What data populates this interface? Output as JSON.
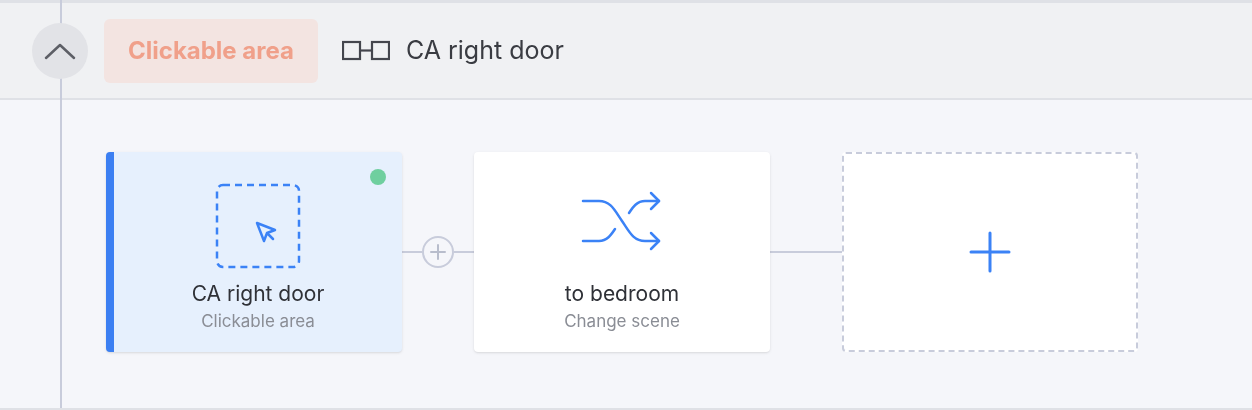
{
  "header": {
    "expanded": true,
    "badge": "Clickable area",
    "title": "CA right door"
  },
  "nodes": [
    {
      "kind": "clickable_area",
      "title": "CA right door",
      "subtitle": "Clickable area",
      "selected": true,
      "color": "#6fcf9f"
    },
    {
      "kind": "change_scene",
      "title": "to bedroom",
      "subtitle": "Change scene",
      "selected": false
    },
    {
      "kind": "add"
    }
  ],
  "connectors": [
    {
      "kind": "insert"
    },
    {
      "kind": "line"
    }
  ]
}
